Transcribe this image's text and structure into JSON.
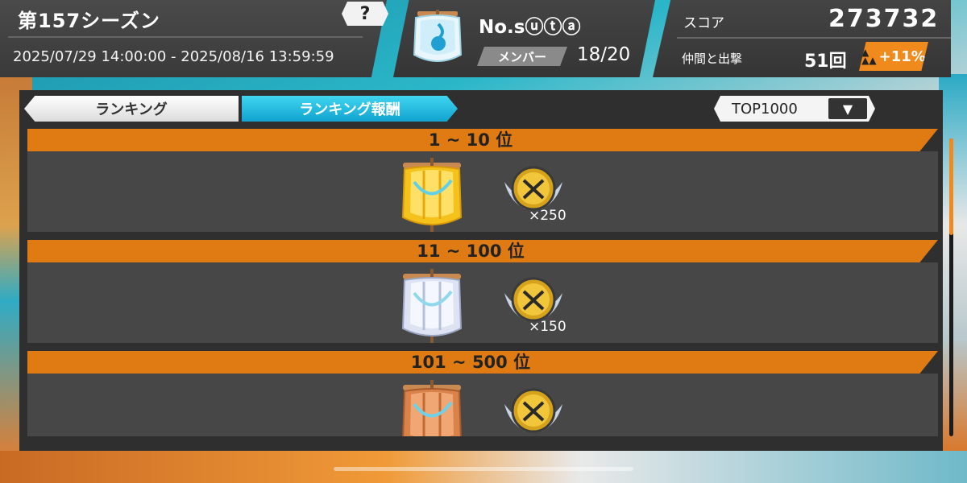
{
  "season": {
    "title": "第157シーズン",
    "help_label": "?",
    "dates": "2025/07/29 14:00:00 - 2025/08/16 13:59:59"
  },
  "crew": {
    "name": "No.sⓤⓣⓐ",
    "member_label": "メンバー",
    "member_count": "18/20"
  },
  "score": {
    "label": "スコア",
    "value": "273732",
    "battle_label": "仲間と出撃",
    "battle_count": "51回",
    "bonus": "+11%"
  },
  "tabs": {
    "ranking": "ランキング",
    "reward": "ランキング報酬",
    "active": "reward"
  },
  "filter": {
    "selected": "TOP1000"
  },
  "tiers": [
    {
      "rank": "1 ~ 10 位",
      "sail": "gold-sail",
      "medal_qty": "×250"
    },
    {
      "rank": "11 ~ 100 位",
      "sail": "silver-sail",
      "medal_qty": "×150"
    },
    {
      "rank": "101 ~ 500 位",
      "sail": "bronze-sail",
      "medal_qty": ""
    }
  ],
  "colors": {
    "accent_orange": "#e07a12",
    "tab_active": "#12a2cf",
    "panel_dark": "#3a3a3a"
  }
}
